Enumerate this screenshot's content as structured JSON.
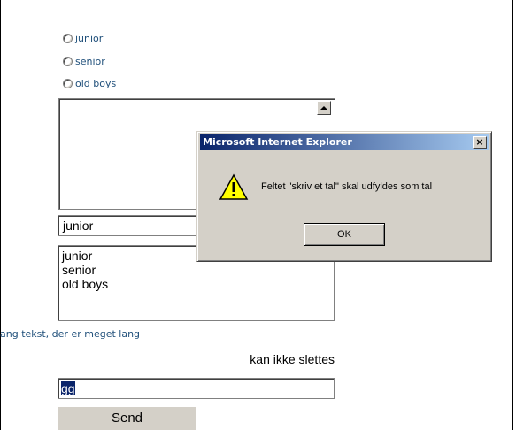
{
  "form": {
    "radios": [
      {
        "label": "junior",
        "checked": false
      },
      {
        "label": "senior",
        "checked": false
      },
      {
        "label": "old boys",
        "checked": false
      }
    ],
    "textarea_value": "",
    "select": {
      "value": "junior"
    },
    "listbox": {
      "options": [
        "junior",
        "senior",
        "old boys"
      ]
    },
    "long_text": "ang tekst, der er meget lang",
    "cannot_delete_label": "kan ikke slettes",
    "text_input_value": "gg",
    "send_label": "Send"
  },
  "dialog": {
    "title": "Microsoft Internet Explorer",
    "message": "Feltet \"skriv et tal\" skal udfyldes som tal",
    "ok_label": "OK",
    "close_symbol": "×",
    "icon": "warning-icon"
  },
  "colors": {
    "titlebar_start": "#0a246a",
    "titlebar_end": "#a6caf0",
    "dialog_bg": "#d4d0c8",
    "link_text": "#1f4f7a"
  }
}
